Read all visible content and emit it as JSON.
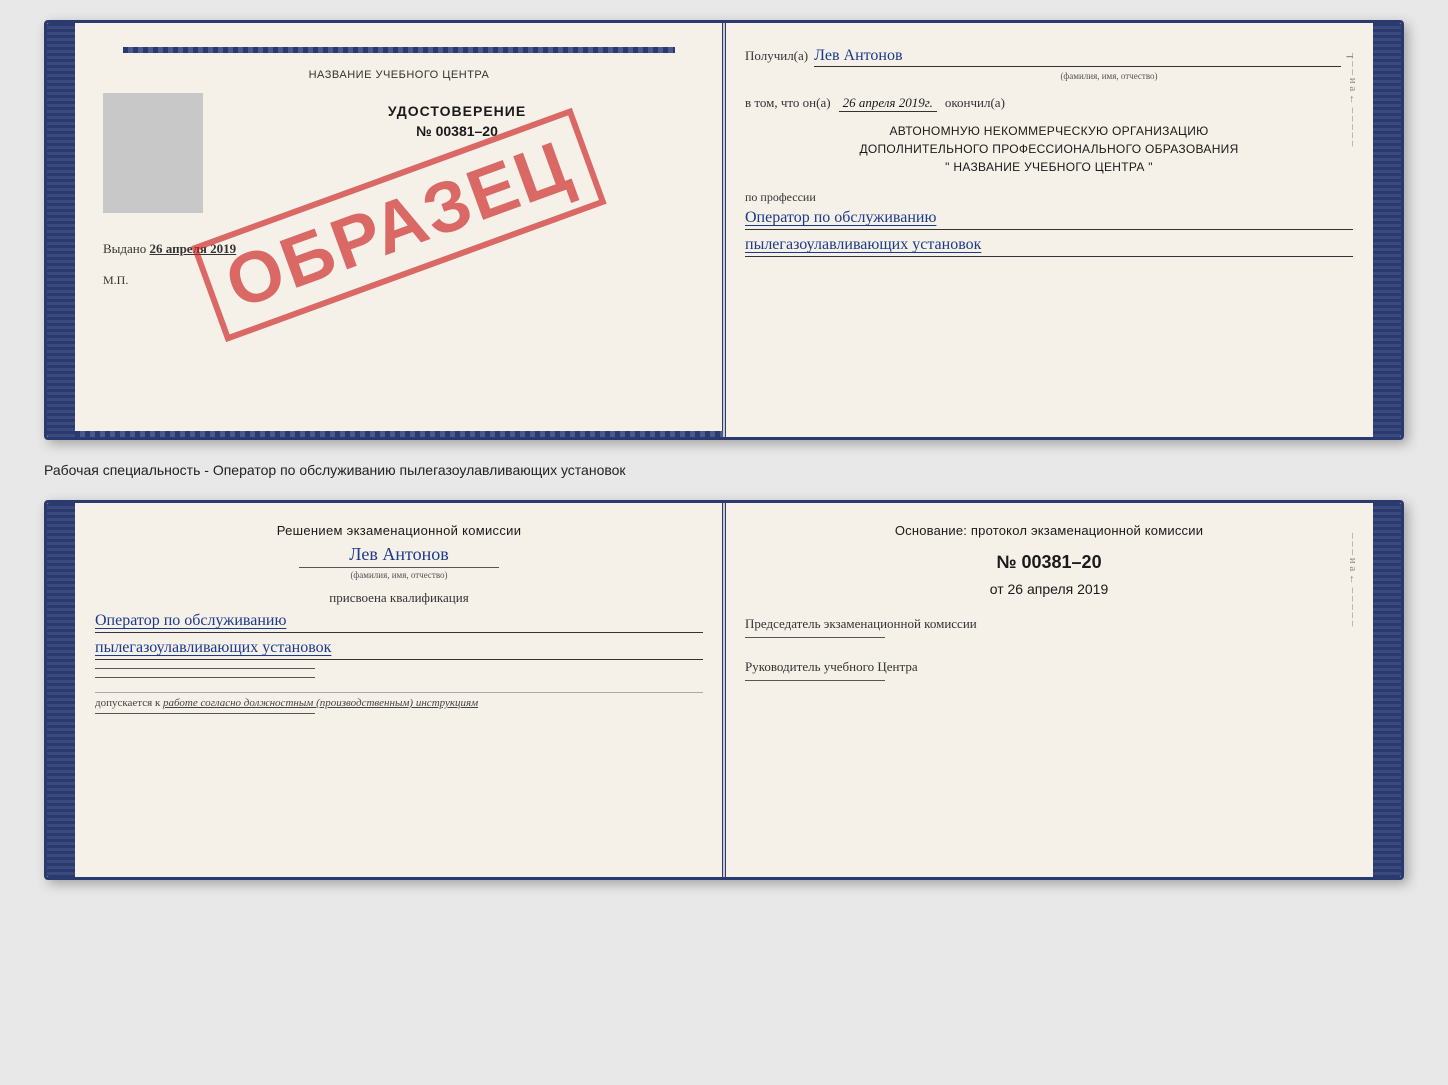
{
  "top_cert": {
    "left": {
      "header": "НАЗВАНИЕ УЧЕБНОГО ЦЕНТРА",
      "title": "УДОСТОВЕРЕНИЕ",
      "number": "№ 00381–20",
      "issued_label": "Выдано",
      "issued_date": "26 апреля 2019",
      "mp_label": "М.П.",
      "stamp": "ОБРАЗЕЦ"
    },
    "right": {
      "received_label": "Получил(а)",
      "received_name": "Лев Антонов",
      "fio_label": "(фамилия, имя, отчество)",
      "date_prefix": "в том, что он(а)",
      "date_value": "26 апреля 2019г.",
      "date_suffix": "окончил(а)",
      "org_line1": "АВТОНОМНУЮ НЕКОММЕРЧЕСКУЮ ОРГАНИЗАЦИЮ",
      "org_line2": "ДОПОЛНИТЕЛЬНОГО ПРОФЕССИОНАЛЬНОГО ОБРАЗОВАНИЯ",
      "org_line3": "\"  НАЗВАНИЕ УЧЕБНОГО ЦЕНТРА  \"",
      "profession_label": "по профессии",
      "profession_line1": "Оператор по обслуживанию",
      "profession_line2": "пылегазоулавливающих установок"
    }
  },
  "middle": {
    "text": "Рабочая специальность - Оператор по обслуживанию пылегазоулавливающих установок"
  },
  "bottom_cert": {
    "left": {
      "decision_text": "Решением экзаменационной комиссии",
      "person_name": "Лев Антонов",
      "fio_label": "(фамилия, имя, отчество)",
      "qualification_label": "присвоена квалификация",
      "qualification_line1": "Оператор по обслуживанию",
      "qualification_line2": "пылегазоулавливающих установок",
      "admitted_label": "допускается к",
      "admitted_value": "работе согласно должностным (производственным) инструкциям"
    },
    "right": {
      "basis_label": "Основание: протокол экзаменационной комиссии",
      "protocol_number": "№  00381–20",
      "protocol_date_prefix": "от",
      "protocol_date": "26 апреля 2019",
      "chairman_label": "Председатель экзаменационной комиссии",
      "director_label": "Руководитель учебного Центра"
    }
  },
  "right_margin_top": [
    "–",
    "–",
    "–",
    "и",
    "а",
    "←",
    "–",
    "–",
    "–",
    "–",
    "–"
  ],
  "right_margin_bottom": [
    "–",
    "–",
    "–",
    "и",
    "а",
    "←",
    "–",
    "–",
    "–",
    "–",
    "–"
  ]
}
